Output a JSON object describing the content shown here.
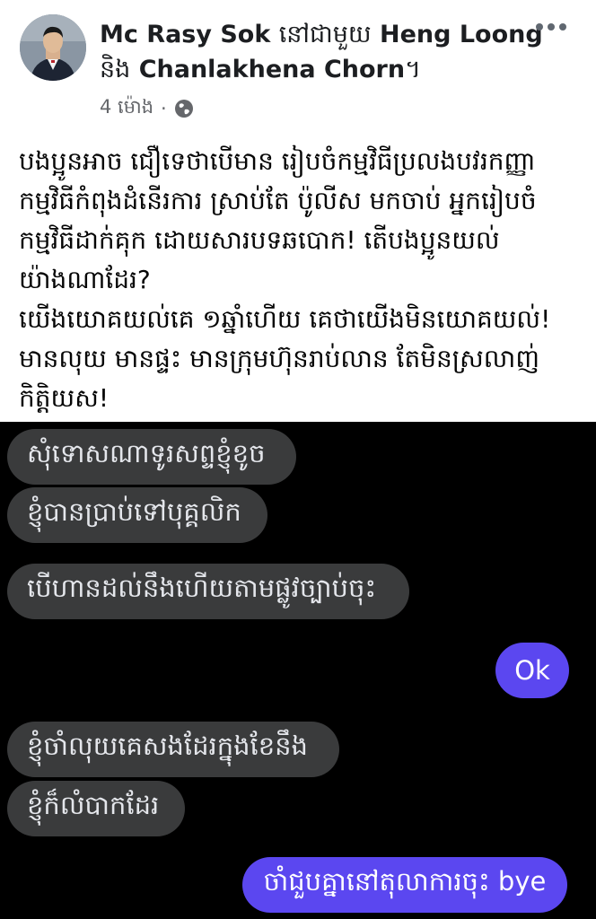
{
  "post": {
    "author": "Mc Rasy Sok",
    "with_word": "នៅជាមួយ",
    "tagged_1": "Heng Loong",
    "and_word": "និង",
    "tagged_2": "Chanlakhena Chorn",
    "tagged_suffix": "។",
    "timestamp": "4 ម៉ោង",
    "separator": "·",
    "audience_icon": "globe-icon",
    "more_icon": "more-horizontal-icon",
    "lines": [
      "បងប្អូនអាច ជឿទេថាបើមាន រៀបចំកម្មវិធីប្រលងបវរកញ្ញា",
      "កម្មវិធីកំពុងដំនើរការ ស្រាប់តែ ប៉ូលីស មកចាប់ អ្នករៀបចំ",
      "កម្មវិធីដាក់គុក ដោយសារបទឆបោក! តើបងប្អូនយល់",
      "យ៉ាងណាដែរ?",
      "យើងយោគយល់គេ ១ឆ្នាំហើយ គេថាយើងមិនយោគយល់!",
      "មានលុយ  មានផ្ទះ មានក្រុមហ៊ុនរាប់លាន តែមិនស្រលាញ់",
      "កិត្តិយស!"
    ]
  },
  "chat": {
    "messages": [
      {
        "dir": "in",
        "text": "សុំទោសណាទូរសព្ទខ្ញុំខូច"
      },
      {
        "dir": "in",
        "text": "ខ្ញុំបានប្រាប់ទៅបុគ្គលិក"
      },
      {
        "dir": "in",
        "text": "បើហានដល់នឹងហើយតាមផ្លូវច្បាប់ចុះ"
      },
      {
        "dir": "out",
        "text": "Ok"
      },
      {
        "dir": "in",
        "text": "ខ្ញុំចាំលុយគេសងដែរក្នុងខែនឹង"
      },
      {
        "dir": "in",
        "text": "ខ្ញុំក៏លំបាកដែរ"
      },
      {
        "dir": "out",
        "text": "ចាំជួបគ្នានៅតុលាការចុះ bye"
      }
    ],
    "colors": {
      "background": "#000000",
      "incoming": "#3a3b3c",
      "outgoing": "#5b47f0"
    }
  }
}
